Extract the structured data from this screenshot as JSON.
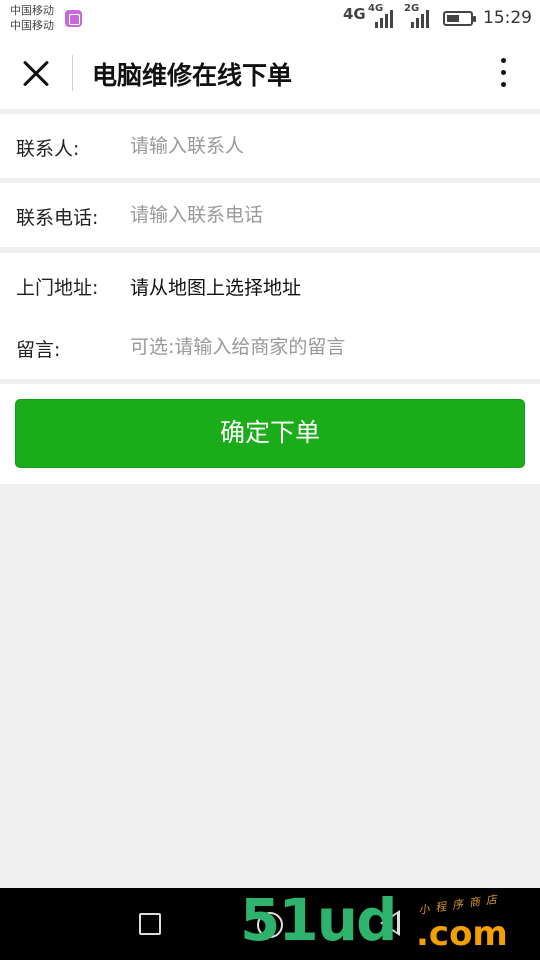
{
  "status_bar": {
    "carrier_1": "中国移动",
    "carrier_2": "中国移动",
    "network_1": "4G",
    "network_2": "4G",
    "network_3": "2G",
    "battery_level": 0.55,
    "time": "15:29"
  },
  "header": {
    "title": "电脑维修在线下单"
  },
  "form": {
    "contact": {
      "label": "联系人:",
      "placeholder": "请输入联系人",
      "value": ""
    },
    "phone": {
      "label": "联系电话:",
      "placeholder": "请输入联系电话",
      "value": ""
    },
    "address": {
      "label": "上门地址:",
      "value": "请从地图上选择地址"
    },
    "message": {
      "label": "留言:",
      "placeholder": "可选:请输入给商家的留言",
      "value": ""
    }
  },
  "submit_label": "确定下单",
  "watermark": {
    "logo": "51ud",
    "suffix": ".com",
    "tagline": "小程序商店"
  },
  "colors": {
    "accent": "#1aad19",
    "background": "#efefef"
  },
  "icons": {
    "close": "close-icon",
    "more": "more-vertical-icon",
    "nav_back": "triangle-back-icon",
    "nav_home": "circle-home-icon",
    "nav_recent": "square-recent-icon"
  }
}
